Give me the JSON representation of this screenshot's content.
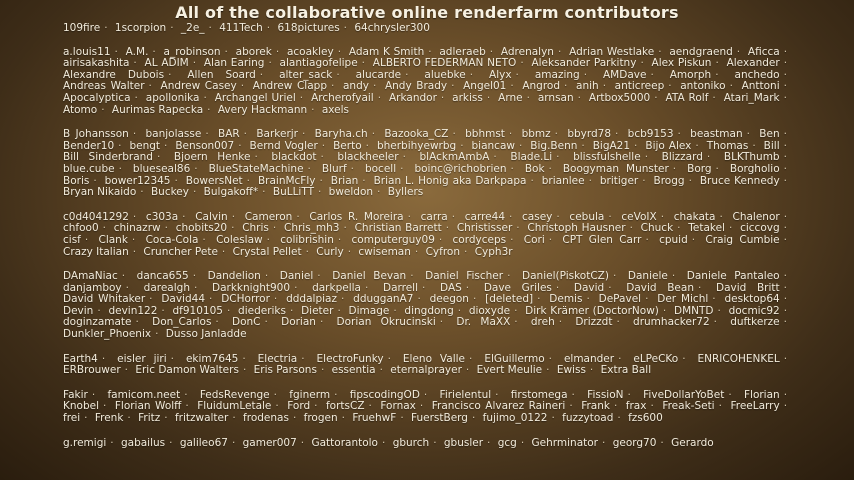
{
  "title": "All of the collaborative online renderfarm contributors",
  "groups": [
    {
      "id": "digits",
      "names": [
        "109fire",
        "1scorpion",
        "_2e_",
        "411Tech",
        "618pictures",
        "64chrysler300"
      ]
    },
    {
      "id": "a",
      "names": [
        "a.louis11",
        "A.M.",
        "a_robinson",
        "aborek",
        "acoakley",
        "Adam K Smith",
        "adleraeb",
        "Adrenalyn",
        "Adrian Westlake",
        "aendgraend",
        "Aficca",
        "airisakashita",
        "AL ADIM",
        "Alan Earing",
        "alantiagofelipe",
        "ALBERTO FEDERMAN NETO",
        "Aleksander Parkitny",
        "Alex Piskun",
        "Alexander",
        "Alexandre Dubois",
        "Allen Soard",
        "alter_sack",
        "alucarde",
        "aluebke",
        "Alyx",
        "amazing",
        "AMDave",
        "Amorph",
        "anchedo",
        "Andreas Walter",
        "Andrew Casey",
        "Andrew Clapp",
        "andy",
        "Andy Brady",
        "Angel01",
        "Angrod",
        "anih",
        "anticreep",
        "antoniko",
        "Anttoni",
        "Apocalyptica",
        "apollonika",
        "Archangel Uriel",
        "Archerofyail",
        "Arkandor",
        "arkiss",
        "Arne",
        "arnsan",
        "Artbox5000",
        "ATA Rolf",
        "Atari_Mark",
        "Atomo",
        "Aurimas Rapecka",
        "Avery Hackmann",
        "axels"
      ]
    },
    {
      "id": "b",
      "names": [
        "B Johansson",
        "banjolasse",
        "BAR",
        "Barkerjr",
        "Baryha.ch",
        "Bazooka_CZ",
        "bbhmst",
        "bbmz",
        "bbyrd78",
        "bcb9153",
        "beastman",
        "Ben",
        "Bender10",
        "bengt",
        "Benson007",
        "Bernd Vogler",
        "Berto",
        "bherbihyewrbg",
        "biancaw",
        "Big.Benn",
        "BigA21",
        "Bijo Alex",
        "Thomas",
        "Bill",
        "Bill Sinderbrand",
        "Bjoern Henke",
        "blackdot",
        "blackheeler",
        "blAckmAmbA",
        "Blade.Li",
        "blissfulshelle",
        "Blizzard",
        "BLKThumb",
        "blue.cube",
        "blueseal86",
        "BlueStateMachine",
        "Blurf",
        "bocell",
        "boinc@richobrien",
        "Bok",
        "Boogyman Munster",
        "Borg",
        "Borgholio",
        "Boris",
        "bower12345",
        "BowersNet",
        "BrainMcFly",
        "Brian",
        "Brian L. Honig aka Darkpapa",
        "brianlee",
        "britiger",
        "Brogg",
        "Bruce Kennedy",
        "Bryan Nikaido",
        "Buckey",
        "Bulgakoff*",
        "BuLLiTT",
        "bweldon",
        "Byllers"
      ]
    },
    {
      "id": "c",
      "names": [
        "c0d4041292",
        "c303a",
        "Calvin",
        "Cameron",
        "Carlos R. Moreira",
        "carra",
        "carre44",
        "casey",
        "cebula",
        "ceVoIX",
        "chakata",
        "Chalenor",
        "chfoo0",
        "chinazrw",
        "chobits20",
        "Chris",
        "Chris_mh3",
        "Christian Barrett",
        "Christisser",
        "Christoph Hausner",
        "Chuck",
        "Tetakel",
        "ciccovg",
        "cisf",
        "Clank",
        "Coca-Cola",
        "Coleslaw",
        "colibrishin",
        "computerguy09",
        "cordyceps",
        "Cori",
        "CPT Glen Carr",
        "cpuid",
        "Craig Cumbie",
        "Crazy Italian",
        "Cruncher Pete",
        "Crystal Pellet",
        "Curly",
        "cwiseman",
        "Cyfron",
        "Cyph3r"
      ]
    },
    {
      "id": "d",
      "names": [
        "DAmaNiac",
        "danca655",
        "Dandelion",
        "Daniel",
        "Daniel Bevan",
        "Daniel Fischer",
        "Daniel(PiskotCZ)",
        "Daniele",
        "Daniele Pantaleo",
        "danjamboy",
        "darealgh",
        "Darkknight900",
        "darkpella",
        "Darrell",
        "DAS",
        "Dave Griles",
        "David",
        "David Bean",
        "David Britt",
        "David Whitaker",
        "David44",
        "DCHorror",
        "dddalpiaz",
        "ddugganA7",
        "deegon",
        "[deleted]",
        "Demis",
        "DePavel",
        "Der Michl",
        "desktop64",
        "Devin",
        "devin122",
        "df910105",
        "diederiks",
        "Dieter",
        "Dimage",
        "dingdong",
        "dioxyde",
        "Dirk Krämer (DoctorNow)",
        "DMNTD",
        "docmic92",
        "doginzamate",
        "Don_Carlos",
        "DonC",
        "Dorian",
        "Dorian Okrucinski",
        "Dr. MaXX",
        "dreh",
        "Drizzdt",
        "drumhacker72",
        "duftkerze",
        "Dunkler_Phoenix",
        "Dusso Janladde"
      ]
    },
    {
      "id": "e",
      "names": [
        "Earth4",
        "eisler jiri",
        "ekim7645",
        "Electria",
        "ElectroFunky",
        "Eleno Valle",
        "ElGuillermo",
        "elmander",
        "eLPeCKo",
        "ENRICOHENKEL",
        "ERBrouwer",
        "Eric Damon Walters",
        "Eris Parsons",
        "essentia",
        "eternalprayer",
        "Evert Meulie",
        "Ewiss",
        "Extra Ball"
      ]
    },
    {
      "id": "f",
      "names": [
        "Fakir",
        "famicom.neet",
        "FedsRevenge",
        "fginerm",
        "fipscodingOD",
        "Firielentul",
        "firstomega",
        "FissioN",
        "FiveDollarYoBet",
        "Florian",
        "Knobel",
        "Florian Wolff",
        "FluidumLetale",
        "Ford",
        "fortsCZ",
        "Fornax",
        "Francisco Alvarez Raineri",
        "Frank",
        "frax",
        "Freak-Seti",
        "FreeLarry",
        "frei",
        "Frenk",
        "Fritz",
        "fritzwalter",
        "frodenas",
        "frogen",
        "FruehwF",
        "FuerstBerg",
        "fujimo_0122",
        "fuzzytoad",
        "fzs600"
      ]
    },
    {
      "id": "g",
      "names": [
        "g.remigi",
        "gabailus",
        "galileo67",
        "gamer007",
        "Gattorantolo",
        "gburch",
        "gbusler",
        "gcg",
        "Gehrminator",
        "georg70",
        "Gerardo"
      ]
    }
  ]
}
